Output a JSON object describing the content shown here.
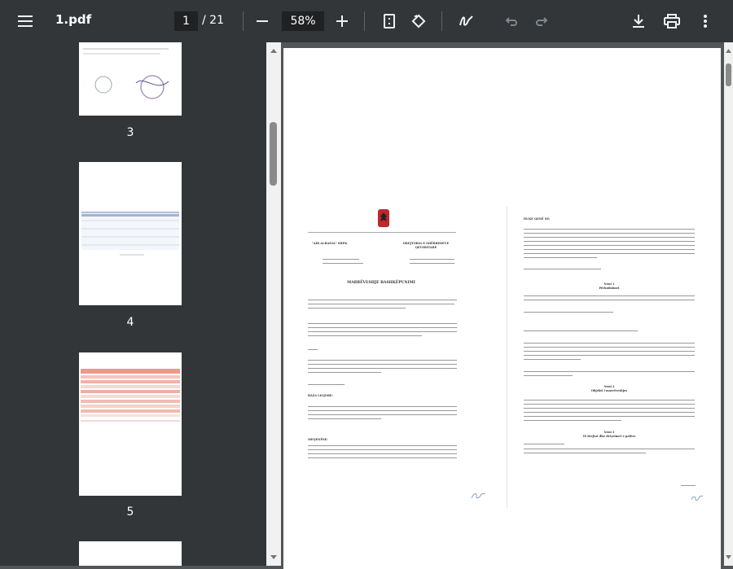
{
  "toolbar": {
    "menu_icon": "hamburger-menu-icon",
    "filename": "1.pdf",
    "current_page": "1",
    "total_pages": "/ 21",
    "zoom": "58%",
    "icons": [
      "zoom-out-icon",
      "zoom-in-icon",
      "fit-page-icon",
      "rotate-icon",
      "annotate-icon",
      "undo-icon",
      "redo-icon",
      "download-icon",
      "print-icon",
      "more-icon"
    ]
  },
  "sidebar": {
    "thumbnails": [
      {
        "label": "3"
      },
      {
        "label": "4"
      },
      {
        "label": "5"
      }
    ]
  },
  "document": {
    "left_page": {
      "org_left": "\"AIR ALBANIA\" SHPK",
      "org_right": "DREJTORIA E SHËRBIMEVE QEVERITARE",
      "title": "MARRËVESHJE BASHKËPUNIMI",
      "section_base": "BAZA LIGJORE:",
      "section_purpose": "MEQENËSE:"
    },
    "right_page": {
      "heading": "DUKE QENË SE:",
      "neni1": "Neni 1",
      "neni1_title": "Përkufizimet",
      "neni2": "Neni 2",
      "neni2_title": "Objekti i marrëveshjes",
      "neni3": "Neni 3",
      "neni3_title": "Të drejtat dhe detyrimet e palëve"
    }
  }
}
